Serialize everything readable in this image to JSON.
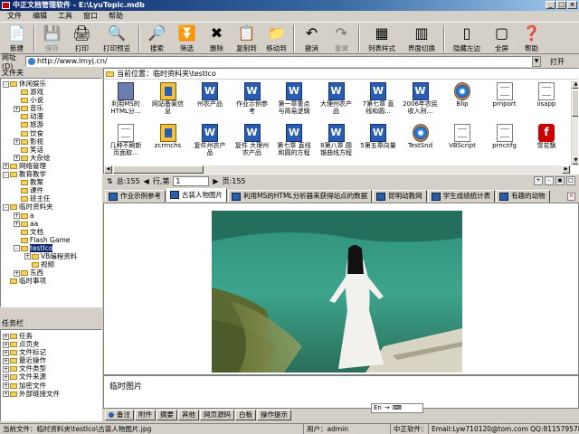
{
  "window": {
    "title": "中正文档管理软件 - E:\\LyuTopic.mdb"
  },
  "menu": [
    "文件",
    "编辑",
    "工具",
    "窗口",
    "帮助"
  ],
  "toolbar": [
    {
      "label": "新建",
      "icon": "new-icon",
      "glyph": "📄"
    },
    {
      "label": "保存",
      "icon": "save-icon",
      "glyph": "💾",
      "disabled": true
    },
    {
      "label": "打印",
      "icon": "print-icon",
      "glyph": "🖨"
    },
    {
      "label": "打印预览",
      "icon": "print-preview-icon",
      "glyph": "🔍"
    },
    {
      "label": "搜索",
      "icon": "search-icon",
      "glyph": "🔎"
    },
    {
      "label": "筛选",
      "icon": "filter-icon",
      "glyph": "⏬"
    },
    {
      "label": "删除",
      "icon": "delete-icon",
      "glyph": "✖"
    },
    {
      "label": "复制到",
      "icon": "copy-to-icon",
      "glyph": "📋"
    },
    {
      "label": "移动到",
      "icon": "move-to-icon",
      "glyph": "📁"
    },
    {
      "label": "撤消",
      "icon": "undo-icon",
      "glyph": "↶"
    },
    {
      "label": "重做",
      "icon": "redo-icon",
      "glyph": "↷",
      "disabled": true
    },
    {
      "label": "列表样式",
      "icon": "list-style-icon",
      "glyph": "▦"
    },
    {
      "label": "界面切换",
      "icon": "layout-switch-icon",
      "glyph": "▥"
    },
    {
      "label": "隐藏左边",
      "icon": "hide-left-icon",
      "glyph": "▯"
    },
    {
      "label": "全屏",
      "icon": "fullscreen-icon",
      "glyph": "▢"
    },
    {
      "label": "帮助",
      "icon": "help-icon",
      "glyph": "❓"
    }
  ],
  "address": {
    "label": "网址(D)",
    "value": "http://www.lmyj.cn/",
    "go_label": "打开"
  },
  "folders": {
    "header": "文件夹",
    "items": [
      {
        "label": "休闲娱乐",
        "level": 0,
        "expand": "-"
      },
      {
        "label": "游戏",
        "level": 1,
        "expand": ""
      },
      {
        "label": "小说",
        "level": 1,
        "expand": ""
      },
      {
        "label": "音乐",
        "level": 1,
        "expand": "+"
      },
      {
        "label": "动漫",
        "level": 1,
        "expand": ""
      },
      {
        "label": "旅游",
        "level": 1,
        "expand": ""
      },
      {
        "label": "饮食",
        "level": 1,
        "expand": ""
      },
      {
        "label": "影视",
        "level": 1,
        "expand": "+"
      },
      {
        "label": "笑话",
        "level": 1,
        "expand": ""
      },
      {
        "label": "大杂烩",
        "level": 1,
        "expand": "+"
      },
      {
        "label": "网络管理",
        "level": 0,
        "expand": "+"
      },
      {
        "label": "教育教学",
        "level": 0,
        "expand": "-"
      },
      {
        "label": "教案",
        "level": 1,
        "expand": ""
      },
      {
        "label": "课件",
        "level": 1,
        "expand": ""
      },
      {
        "label": "班主任",
        "level": 1,
        "expand": ""
      },
      {
        "label": "临时资料夹",
        "level": 0,
        "expand": "-"
      },
      {
        "label": "a",
        "level": 1,
        "expand": "+"
      },
      {
        "label": "aa",
        "level": 1,
        "expand": "+"
      },
      {
        "label": "文档",
        "level": 1,
        "expand": ""
      },
      {
        "label": "Flash Game",
        "level": 1,
        "expand": ""
      },
      {
        "label": "testIco",
        "level": 1,
        "expand": "-",
        "selected": true
      },
      {
        "label": "VB编程资料",
        "level": 2,
        "expand": "+"
      },
      {
        "label": "视频",
        "level": 2,
        "expand": ""
      },
      {
        "label": "东西",
        "level": 1,
        "expand": "+"
      },
      {
        "label": "临时事项",
        "level": 0,
        "expand": ""
      }
    ]
  },
  "taskbar": {
    "header": "任务栏",
    "items": [
      "任务",
      "点页夹",
      "文件标记",
      "最近操作",
      "文件类型",
      "文件来源",
      "加密文件",
      "外部链接文件"
    ]
  },
  "browser": {
    "breadcrumb": "当前位置：临时资料夹\\testIco",
    "files": [
      {
        "name": "利用MS的HTML分...",
        "type": "net"
      },
      {
        "name": "网站备案信息",
        "type": "chm"
      },
      {
        "name": "州农产品",
        "type": "word"
      },
      {
        "name": "作业示例参考",
        "type": "word"
      },
      {
        "name": "第一章重点与简易逻辑",
        "type": "word"
      },
      {
        "name": "大理州农产品",
        "type": "word"
      },
      {
        "name": "7第七章 直线和圆...",
        "type": "word"
      },
      {
        "name": "2006年农民收入刑...",
        "type": "word"
      },
      {
        "name": "Blip",
        "type": "media"
      },
      {
        "name": "prnport",
        "type": "doc"
      },
      {
        "name": "iisapp",
        "type": "doc"
      },
      {
        "name": "几种不刷新页面取...",
        "type": "doc"
      },
      {
        "name": "zcrrnchs",
        "type": "chm"
      },
      {
        "name": "复件州农产品",
        "type": "word"
      },
      {
        "name": "复件 大理州农产品",
        "type": "word"
      },
      {
        "name": "第七章 直线和圆的方程",
        "type": "word"
      },
      {
        "name": "8第八章 圆锥曲线方程",
        "type": "word"
      },
      {
        "name": "5第五章向量",
        "type": "word"
      },
      {
        "name": "TestSnd",
        "type": "media"
      },
      {
        "name": "VBScript",
        "type": "doc"
      },
      {
        "name": "prncnfg",
        "type": "doc"
      },
      {
        "name": "雪花飘",
        "type": "flash"
      }
    ]
  },
  "nav": {
    "total_label": "总:155",
    "page_label": "行,第",
    "page_value": "1",
    "page_total": "页:155"
  },
  "tabs": [
    "作业示例参考",
    "古装人物图片",
    "利用MS的HTML分析器来获得站点的数据",
    "昆明动教网",
    "学生成绩统计表",
    "有趣的动物"
  ],
  "memo": {
    "text": "临时图片"
  },
  "bottom_tabs": [
    "备注",
    "附件",
    "摘要",
    "其他",
    "网页源码",
    "白板",
    "操作提示"
  ],
  "ime": {
    "text": "En"
  },
  "status": {
    "file": "当前文件：临时资料夹\\testIco\\古装人物图片.jpg",
    "user": "用户：admin",
    "software": "中正软件：",
    "email": "Email:Lyw710120@tom.com  QQ:811579578"
  }
}
